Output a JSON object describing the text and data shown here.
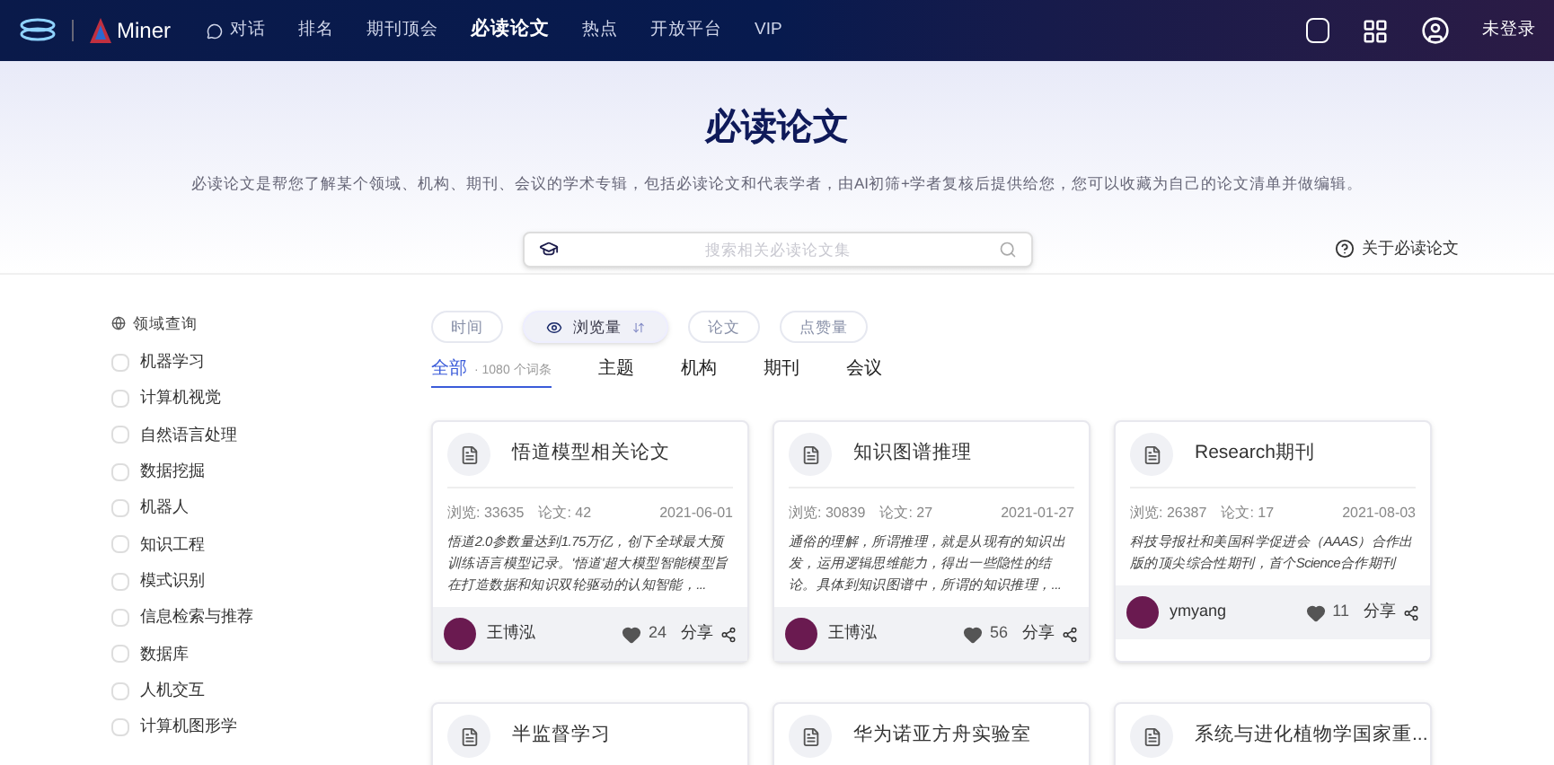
{
  "nav": {
    "logo_text": "Miner",
    "items": [
      {
        "label": "对话",
        "selected": false,
        "kind": "chat"
      },
      {
        "label": "排名",
        "selected": false
      },
      {
        "label": "期刊顶会",
        "selected": false
      },
      {
        "label": "必读论文",
        "selected": true
      },
      {
        "label": "热点",
        "selected": false
      },
      {
        "label": "开放平台",
        "selected": false
      },
      {
        "label": "VIP",
        "selected": false
      }
    ],
    "login": "未登录"
  },
  "hero": {
    "title": "必读论文",
    "subtitle": "必读论文是帮您了解某个领域、机构、期刊、会议的学术专辑，包括必读论文和代表学者，由AI初筛+学者复核后提供给您，您可以收藏为自己的论文清单并做编辑。",
    "search": {
      "placeholder": "搜索相关必读论文集"
    },
    "about": "关于必读论文"
  },
  "sidebar": {
    "title": "领域查询",
    "items": [
      {
        "label": "机器学习",
        "checked": false
      },
      {
        "label": "计算机视觉",
        "checked": false
      },
      {
        "label": "自然语言处理",
        "checked": false
      },
      {
        "label": "数据挖掘",
        "checked": false
      },
      {
        "label": "机器人",
        "checked": false
      },
      {
        "label": "知识工程",
        "checked": false
      },
      {
        "label": "模式识别",
        "checked": false
      },
      {
        "label": "信息检索与推荐",
        "checked": false
      },
      {
        "label": "数据库",
        "checked": false
      },
      {
        "label": "人机交互",
        "checked": false
      },
      {
        "label": "计算机图形学",
        "checked": false
      }
    ]
  },
  "sort_chips": [
    {
      "label": "时间",
      "selected": false
    },
    {
      "label": "浏览量",
      "selected": true
    },
    {
      "label": "论文",
      "selected": false
    },
    {
      "label": "点赞量",
      "selected": false
    }
  ],
  "tabs": [
    {
      "label": "全部",
      "count": "· 1080 个词条",
      "selected": true
    },
    {
      "label": "主题",
      "selected": false
    },
    {
      "label": "机构",
      "selected": false
    },
    {
      "label": "期刊",
      "selected": false
    },
    {
      "label": "会议",
      "selected": false
    }
  ],
  "cards": [
    {
      "title": "悟道模型相关论文",
      "views": "浏览: 33635",
      "papers": "论文: 42",
      "date": "2021-06-01",
      "desc": "悟道2.0参数量达到1.75万亿，创下全球最大预训练语言模型记录。'悟道'超大模型智能模型旨在打造数据和知识双轮驱动的认知智能，...",
      "author": "王博泓",
      "likes": "24",
      "share": "分享"
    },
    {
      "title": "知识图谱推理",
      "views": "浏览: 30839",
      "papers": "论文: 27",
      "date": "2021-01-27",
      "desc": "通俗的理解，所谓推理，就是从现有的知识出发，运用逻辑思维能力，得出一些隐性的结论。具体到知识图谱中，所谓的知识推理，...",
      "author": "王博泓",
      "likes": "56",
      "share": "分享"
    },
    {
      "title": "Research期刊",
      "views": "浏览: 26387",
      "papers": "论文: 17",
      "date": "2021-08-03",
      "desc": "科技导报社和美国科学促进会（AAAS）合作出版的顶尖综合性期刊，首个Science合作期刊",
      "author": "ymyang",
      "likes": "11",
      "share": "分享"
    },
    {
      "title": "半监督学习"
    },
    {
      "title": "华为诺亚方舟实验室"
    },
    {
      "title": "系统与进化植物学国家重..."
    }
  ]
}
